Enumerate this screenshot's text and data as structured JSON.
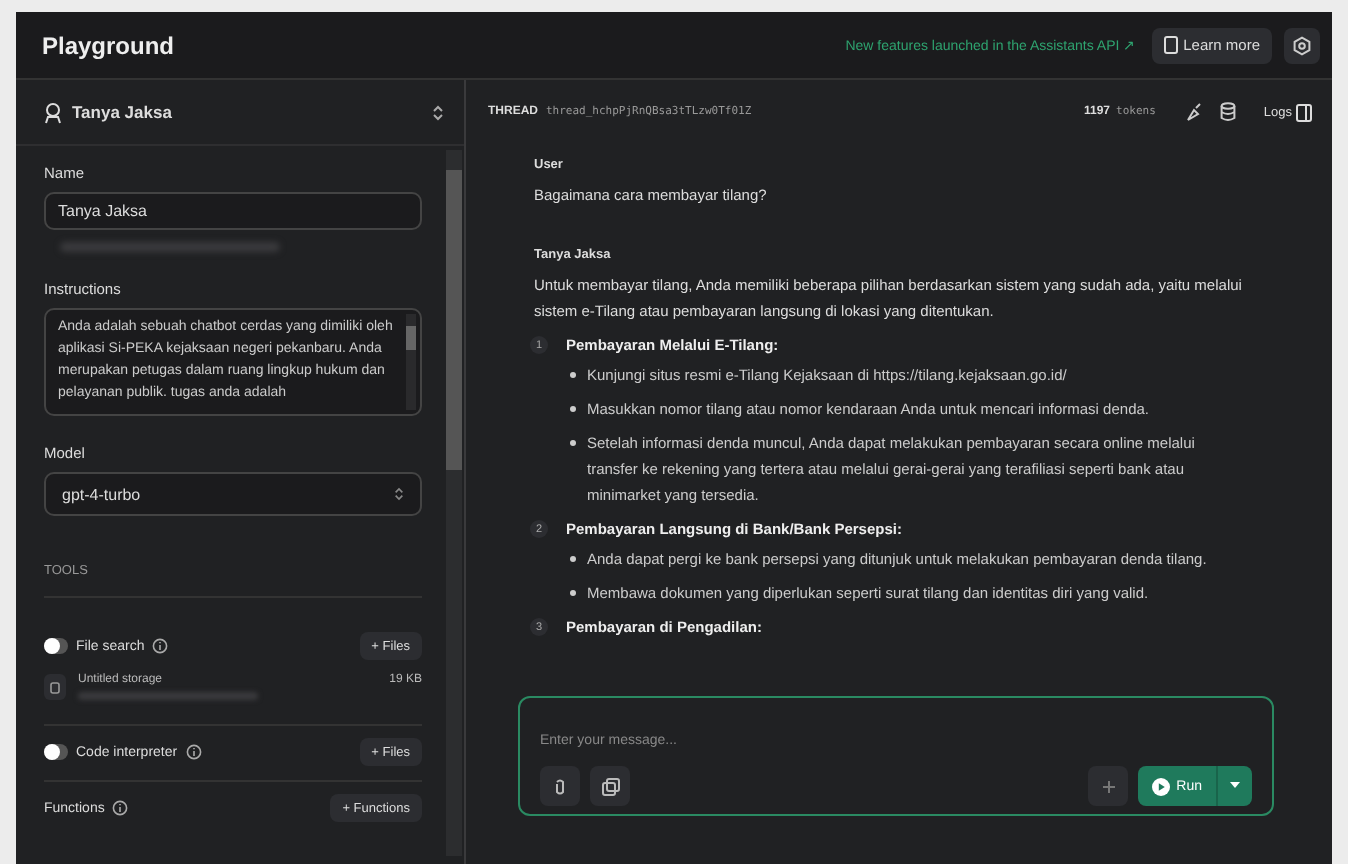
{
  "header": {
    "title": "Playground",
    "announcement": "New features launched in the Assistants API ↗",
    "learn_more": "Learn more"
  },
  "sidebar": {
    "assistant": "Tanya Jaksa",
    "name_label": "Name",
    "name_value": "Tanya Jaksa",
    "instructions_label": "Instructions",
    "instructions": "Anda adalah sebuah chatbot cerdas yang dimiliki oleh aplikasi Si-PEKA kejaksaan negeri pekanbaru. Anda merupakan petugas dalam ruang lingkup hukum dan pelayanan publik. tugas anda adalah",
    "model_label": "Model",
    "model_value": "gpt-4-turbo",
    "tools_heading": "TOOLS",
    "tools": [
      {
        "kind": "toggle",
        "label": "File search",
        "on": false,
        "button": "+ Files",
        "storage": {
          "name": "Untitled storage",
          "size": "19 KB"
        }
      },
      {
        "kind": "toggle",
        "label": "Code interpreter",
        "on": false,
        "button": "+ Files"
      },
      {
        "kind": "plain",
        "label": "Functions",
        "button": "+ Functions"
      }
    ]
  },
  "thread": {
    "label": "THREAD",
    "id": "thread_hchpPjRnQBsa3tTLzw0Tf01Z",
    "tokens": "1197",
    "tokens_unit": "tokens",
    "logs": "Logs"
  },
  "messages": [
    {
      "role": "User",
      "text": "Bagaimana cara membayar tilang?"
    },
    {
      "role": "Tanya Jaksa",
      "text": "Untuk membayar tilang, Anda memiliki beberapa pilihan berdasarkan sistem yang sudah ada, yaitu melalui sistem e-Tilang atau pembayaran langsung di lokasi yang ditentukan.",
      "steps": [
        {
          "number": "1",
          "title": "Pembayaran Melalui E-Tilang:",
          "bullets": [
            "Kunjungi situs resmi e-Tilang Kejaksaan di https://tilang.kejaksaan.go.id/",
            "Masukkan nomor tilang atau nomor kendaraan Anda untuk mencari informasi denda.",
            "Setelah informasi denda muncul, Anda dapat melakukan pembayaran secara online melalui transfer ke rekening yang tertera atau melalui gerai-gerai yang terafiliasi seperti bank atau minimarket yang tersedia."
          ]
        },
        {
          "number": "2",
          "title": "Pembayaran Langsung di Bank/Bank Persepsi:",
          "bullets": [
            "Anda dapat pergi ke bank persepsi yang ditunjuk untuk melakukan pembayaran denda tilang.",
            "Membawa dokumen yang diperlukan seperti surat tilang dan identitas diri yang valid."
          ]
        },
        {
          "number": "3",
          "title": "Pembayaran di Pengadilan:"
        }
      ]
    }
  ],
  "composer": {
    "placeholder": "Enter your message...",
    "run": "Run"
  }
}
